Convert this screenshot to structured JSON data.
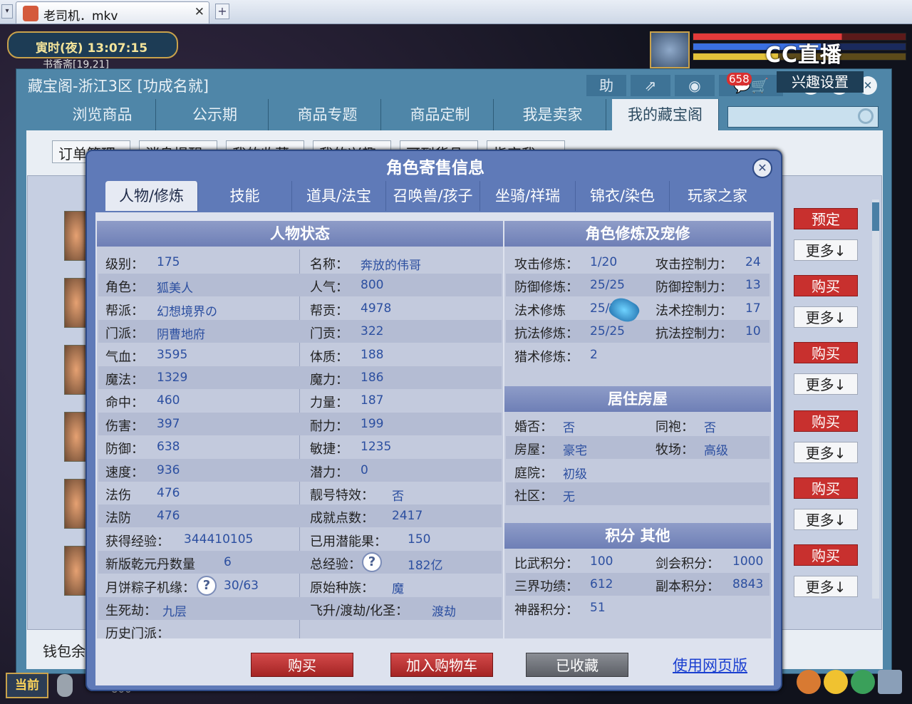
{
  "browser": {
    "tab_title": "老司机．mkv",
    "tab_close": "✕",
    "new_tab": "+"
  },
  "game_hud": {
    "time": "寅时(夜)  13:07:15",
    "sub_text": "书香斋[19,21]",
    "watermark": "CC直播",
    "current_channel": "当前",
    "chat_text": "800"
  },
  "outer_window": {
    "title": "藏宝阁-浙江3区 [功成名就]",
    "tools": [
      "助",
      "⇗",
      "◉",
      "658"
    ],
    "message_count": "658",
    "controls": [
      "—",
      "⚙",
      "✕"
    ],
    "nav": [
      "浏览商品",
      "公示期",
      "商品专题",
      "商品定制",
      "我是卖家",
      "我的藏宝阁"
    ],
    "subtabs": [
      "订单管理",
      "消息提醒",
      "我的收藏",
      "我的兴趣",
      "可到货品",
      "指定我"
    ],
    "interest_settings": "兴趣设置",
    "wallet": "钱包余",
    "side_buttons": [
      "预定",
      "更多↓",
      "购买",
      "更多↓",
      "购买",
      "更多↓",
      "购买",
      "更多↓",
      "购买",
      "更多↓",
      "购买",
      "更多↓"
    ]
  },
  "modal": {
    "title": "角色寄售信息",
    "close": "✕",
    "tabs": [
      "人物/修炼",
      "技能",
      "道具/法宝",
      "召唤兽/孩子",
      "坐骑/祥瑞",
      "锦衣/染色",
      "玩家之家"
    ],
    "status": {
      "header": "人物状态",
      "left": [
        {
          "label": "级别：",
          "value": "175"
        },
        {
          "label": "角色：",
          "value": "狐美人"
        },
        {
          "label": "帮派：",
          "value": "幻想境界の"
        },
        {
          "label": "门派：",
          "value": "阴曹地府"
        },
        {
          "label": "气血：",
          "value": "3595"
        },
        {
          "label": "魔法：",
          "value": "1329"
        },
        {
          "label": "命中：",
          "value": "460"
        },
        {
          "label": "伤害：",
          "value": "397"
        },
        {
          "label": "防御：",
          "value": "638"
        },
        {
          "label": "速度：",
          "value": "936"
        },
        {
          "label": "法伤",
          "value": "476"
        },
        {
          "label": "法防",
          "value": "476"
        },
        {
          "label": "获得经验：",
          "value": "344410105"
        },
        {
          "label": "新版乾元丹数量",
          "value": "6"
        },
        {
          "label": "月饼粽子机缘：",
          "value": "30/63"
        },
        {
          "label": "生死劫：",
          "value": "九层"
        },
        {
          "label": "历史门派：",
          "value": ""
        }
      ],
      "right": [
        {
          "label": "名称：",
          "value": "奔放的伟哥"
        },
        {
          "label": "人气：",
          "value": "800"
        },
        {
          "label": "帮贡：",
          "value": "4978"
        },
        {
          "label": "门贡：",
          "value": "322"
        },
        {
          "label": "体质：",
          "value": "188"
        },
        {
          "label": "魔力：",
          "value": "186"
        },
        {
          "label": "力量：",
          "value": "187"
        },
        {
          "label": "耐力：",
          "value": "199"
        },
        {
          "label": "敏捷：",
          "value": "1235"
        },
        {
          "label": "潜力：",
          "value": "0"
        },
        {
          "label": "靓号特效：",
          "value": "否"
        },
        {
          "label": "成就点数：",
          "value": "2417"
        },
        {
          "label": "已用潜能果：",
          "value": "150"
        },
        {
          "label": "总经验：",
          "value": "182亿"
        },
        {
          "label": "原始种族：",
          "value": "魔"
        },
        {
          "label": "飞升/渡劫/化圣：",
          "value": "渡劫"
        }
      ],
      "qmark": "?"
    },
    "cultivation": {
      "header": "角色修炼及宠修",
      "left": [
        {
          "label": "攻击修炼：",
          "value": "1/20"
        },
        {
          "label": "防御修炼：",
          "value": "25/25"
        },
        {
          "label": "法术修炼",
          "value": "25/25"
        },
        {
          "label": "抗法修炼：",
          "value": "25/25"
        },
        {
          "label": "猎术修炼：",
          "value": "2"
        }
      ],
      "right": [
        {
          "label": "攻击控制力：",
          "value": "24"
        },
        {
          "label": "防御控制力：",
          "value": "13"
        },
        {
          "label": "法术控制力：",
          "value": "17"
        },
        {
          "label": "抗法控制力：",
          "value": "10"
        }
      ]
    },
    "housing": {
      "header": "居住房屋",
      "left": [
        {
          "label": "婚否：",
          "value": "否"
        },
        {
          "label": "房屋：",
          "value": "豪宅"
        },
        {
          "label": "庭院：",
          "value": "初级"
        },
        {
          "label": "社区：",
          "value": "无"
        }
      ],
      "right": [
        {
          "label": "同袍：",
          "value": "否"
        },
        {
          "label": "牧场：",
          "value": "高级"
        }
      ]
    },
    "points": {
      "header": "积分 其他",
      "left": [
        {
          "label": "比武积分：",
          "value": "100"
        },
        {
          "label": "三界功绩：",
          "value": "612"
        },
        {
          "label": "神器积分：",
          "value": "51"
        }
      ],
      "right": [
        {
          "label": "剑会积分：",
          "value": "1000"
        },
        {
          "label": "副本积分：",
          "value": "8843"
        }
      ]
    },
    "buttons": {
      "buy": "购买",
      "add_cart": "加入购物车",
      "collected": "已收藏",
      "web_version": "使用网页版"
    }
  }
}
